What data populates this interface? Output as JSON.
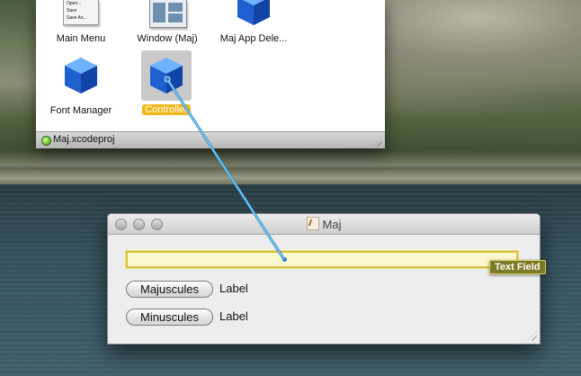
{
  "file_window": {
    "objects": [
      {
        "label": "Main Menu",
        "icon": "main-menu-thumbnail",
        "menu_lines": [
          "Open...",
          "Save",
          "Save As..."
        ]
      },
      {
        "label": "Window (Maj)",
        "icon": "window-thumbnail"
      },
      {
        "label": "Maj App Dele...",
        "icon": "blue-cube-icon"
      },
      {
        "label": "Font Manager",
        "icon": "blue-cube-icon"
      },
      {
        "label": "Controller",
        "icon": "blue-cube-icon",
        "selected": true
      }
    ],
    "status": "Maj.xcodeproj"
  },
  "maj_window": {
    "title": "Maj",
    "text_field_value": "",
    "buttons": [
      {
        "label": "Majuscules",
        "side_label": "Label"
      },
      {
        "label": "Minuscules",
        "side_label": "Label"
      }
    ]
  },
  "connection_tag": "Text Field",
  "colors": {
    "selection": "#f1b719",
    "connection_line": "#5bb8e6",
    "text_field_fill": "#fbf7cf",
    "tag_bg": "#7d7a26"
  }
}
